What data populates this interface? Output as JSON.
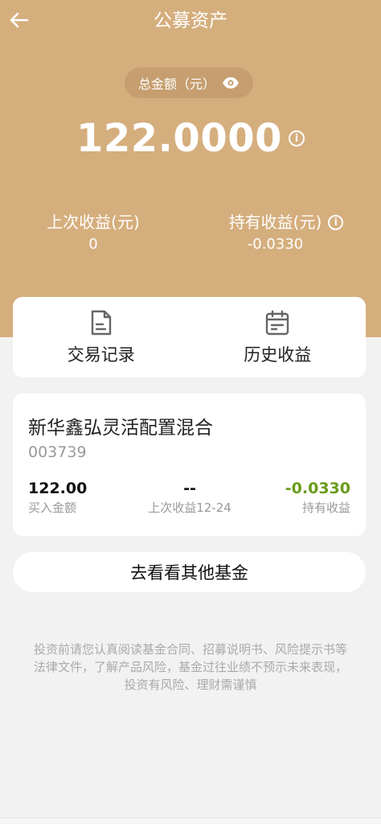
{
  "header": {
    "title": "公募资产",
    "back_icon": "arrow-left-icon"
  },
  "summary": {
    "total_label": "总金额（元）",
    "total_value": "122.0000",
    "info_glyph": "i",
    "last_income_label": "上次收益(元)",
    "last_income_value": "0",
    "holding_income_label": "持有收益(元)",
    "holding_income_value": "-0.0330"
  },
  "tabs": [
    {
      "label": "交易记录",
      "icon": "document-icon"
    },
    {
      "label": "历史收益",
      "icon": "calendar-icon"
    }
  ],
  "fund": {
    "name": "新华鑫弘灵活配置混合",
    "code": "003739",
    "buy_amount_value": "122.00",
    "buy_amount_label": "买入金额",
    "last_income_value": "--",
    "last_income_label": "上次收益12-24",
    "holding_income_value": "-0.0330",
    "holding_income_label": "持有收益"
  },
  "cta": {
    "label": "去看看其他基金"
  },
  "disclaimer": [
    "投资前请您认真阅读基金合同、招募说明书、风险提示书等",
    "法律文件，了解产品风险，基金过往业绩不预示未来表现，",
    "投资有风险、理财需谨慎"
  ],
  "colors": {
    "hero_bg": "#d5ae7d",
    "negative_green": "#6a9b1a",
    "page_bg": "#f2f2f2"
  }
}
